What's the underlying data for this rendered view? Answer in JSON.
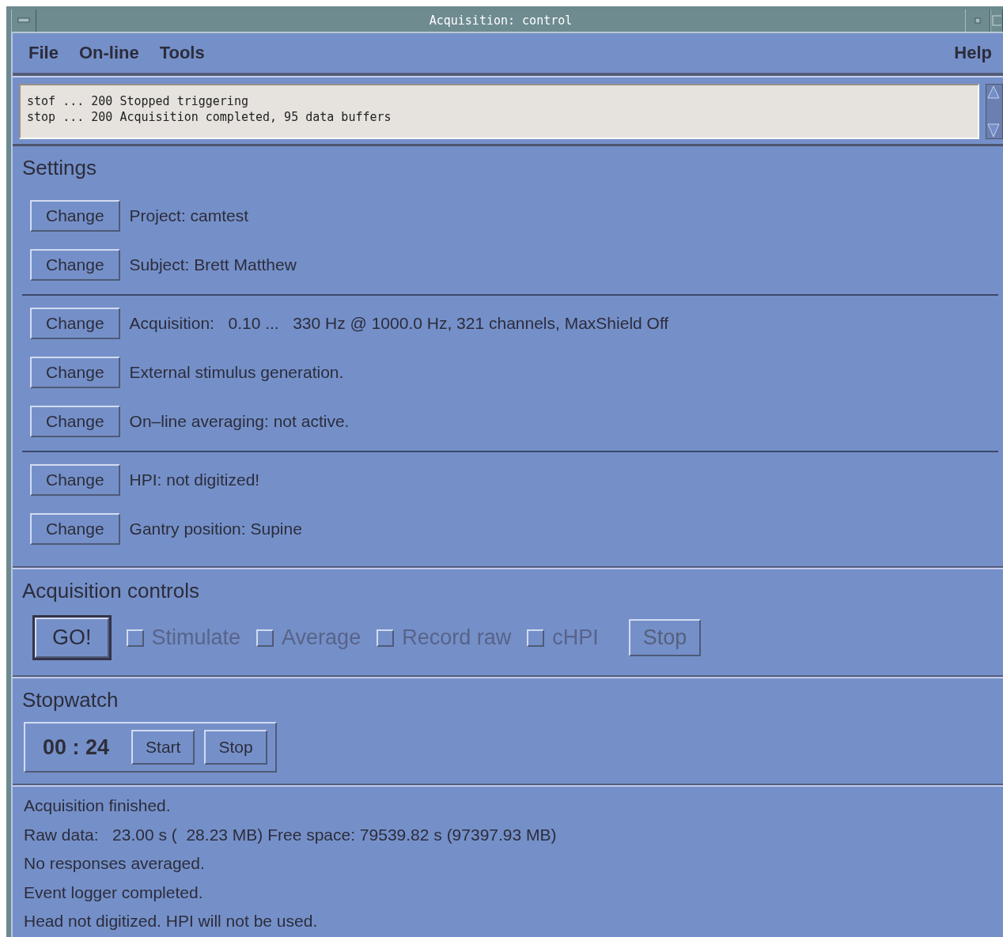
{
  "window": {
    "title": "Acquisition: control"
  },
  "menu": {
    "left": [
      {
        "label": "File"
      },
      {
        "label": "On-line"
      },
      {
        "label": "Tools"
      }
    ],
    "right": [
      {
        "label": "Help"
      }
    ]
  },
  "log": {
    "lines": [
      "stof ... 200 Stopped triggering",
      "stop ... 200 Acquisition completed, 95 data buffers"
    ]
  },
  "settings": {
    "title": "Settings",
    "groups": [
      [
        {
          "button": "Change",
          "text": "Project: camtest"
        },
        {
          "button": "Change",
          "text": "Subject: Brett Matthew"
        }
      ],
      [
        {
          "button": "Change",
          "text": "Acquisition:   0.10 ...   330 Hz @ 1000.0 Hz, 321 channels, MaxShield Off"
        },
        {
          "button": "Change",
          "text": "External stimulus generation."
        },
        {
          "button": "Change",
          "text": "On–line averaging: not active."
        }
      ],
      [
        {
          "button": "Change",
          "text": "HPI: not digitized!"
        },
        {
          "button": "Change",
          "text": "Gantry position: Supine"
        }
      ]
    ]
  },
  "acquisition_controls": {
    "title": "Acquisition controls",
    "items": [
      {
        "kind": "button",
        "label": "GO!",
        "default": true,
        "disabled": false
      },
      {
        "kind": "checkbox",
        "label": "Stimulate",
        "checked": false,
        "disabled": true
      },
      {
        "kind": "checkbox",
        "label": "Average",
        "checked": false,
        "disabled": true
      },
      {
        "kind": "checkbox",
        "label": "Record raw",
        "checked": false,
        "disabled": true
      },
      {
        "kind": "checkbox",
        "label": "cHPI",
        "checked": false,
        "disabled": true
      },
      {
        "kind": "button",
        "label": "Stop",
        "default": false,
        "disabled": true
      }
    ]
  },
  "stopwatch": {
    "title": "Stopwatch",
    "time": "00 : 24",
    "buttons": [
      "Start",
      "Stop"
    ]
  },
  "status": [
    "Acquisition finished.",
    "Raw data:   23.00 s (  28.23 MB) Free space: 79539.82 s (97397.93 MB)",
    "No responses averaged.",
    "Event logger completed.",
    "Head not digitized. HPI will not be used."
  ]
}
